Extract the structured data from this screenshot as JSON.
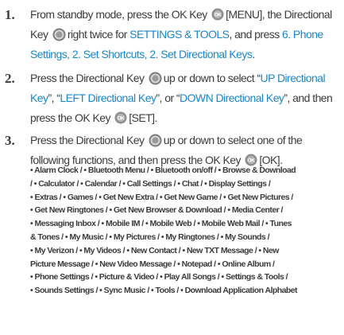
{
  "steps": [
    {
      "number": "1.",
      "lines": [
        [
          "From standby mode, press the OK Key ",
          "[MENU], the Directional"
        ],
        [
          "Key ",
          "right twice for ",
          "SETTINGS & TOOLS",
          ", and press ",
          "6. Phone"
        ],
        [
          "Settings, 2. Set Shortcuts, 2. Set Directional Keys",
          "."
        ]
      ]
    },
    {
      "number": "2.",
      "lines": [
        [
          "Press the Directional Key ",
          "up or down to select “",
          "UP Directional"
        ],
        [
          "Key",
          "”, “",
          "LEFT Directional Key",
          "”, or “",
          "DOWN Directional Key",
          "”, and then"
        ],
        [
          "press the OK Key ",
          "[SET]."
        ]
      ]
    },
    {
      "number": "3.",
      "lines": [
        [
          "Press the Directional Key ",
          "up or down to select one of the"
        ],
        [
          "following functions, and then press the OK Key ",
          "[OK]."
        ]
      ]
    }
  ],
  "functions": [
    "• Alarm Clock / • Bluetooth Menu / • Bluetooth on/off / • Browse & Download",
    "/ • Calculator / • Calendar / • Call Settings / • Chat / • Display Settings /",
    "• Extras / • Games / • Get New Extra / • Get New Game / • Get New Pictures /",
    "• Get New Ringtones / • Get New Browser & Download / • Media Center /",
    "• Messaging Inbox / • Mobile IM / • Mobile Web / • Mobile Web Mail / • Tunes",
    "& Tones / • My Music / • My Pictures / • My Ringtones / • My Sounds /",
    "• My Verizon / • My Videos / • New Contact / • New TXT Message / • New",
    "Picture Message / • New Video Message / • Notepad / • Online Album /",
    "• Phone Settings / • Picture & Video / • Play All Songs / • Settings & Tools /",
    "• Sounds Settings / • Sync Music / • Tools / • Download Application Alphabet"
  ],
  "colors": {
    "text": "#3b3b3b",
    "highlight": "#1a86c8"
  },
  "icons": {
    "ok_key": "ok-key-icon",
    "directional_key": "directional-key-icon"
  }
}
